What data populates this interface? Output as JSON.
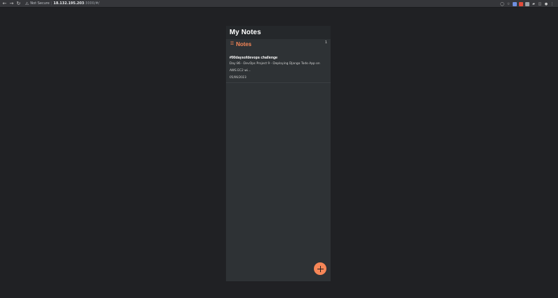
{
  "browser": {
    "nav_icons": [
      "arrow-left-icon",
      "arrow-right-icon",
      "reload-icon"
    ],
    "security_label": "Not Secure",
    "host": "18.132.195.203",
    "port_path": ":3000/#/",
    "extension_icons": [
      "share-icon",
      "star-icon",
      "extension-blue-icon",
      "extension-red-icon",
      "extension-icon",
      "puzzle-icon",
      "sidebar-icon",
      "profile-icon",
      "menu-icon"
    ]
  },
  "app": {
    "title": "My Notes",
    "notes_header": {
      "icon": "notes-list-icon",
      "label": "Notes",
      "count": "1"
    },
    "notes": [
      {
        "title": "#90daysofdevops challenge",
        "preview": "Day 86 - DevOps Project 9 - Deploying Django Todo App on AWS EC2 wi...",
        "date": "05/06/2023"
      }
    ],
    "fab_icon": "plus-icon"
  },
  "colors": {
    "accent": "#f68657",
    "page_background": "#202124",
    "panel_background": "#2e3235",
    "header_background": "#25282b"
  }
}
